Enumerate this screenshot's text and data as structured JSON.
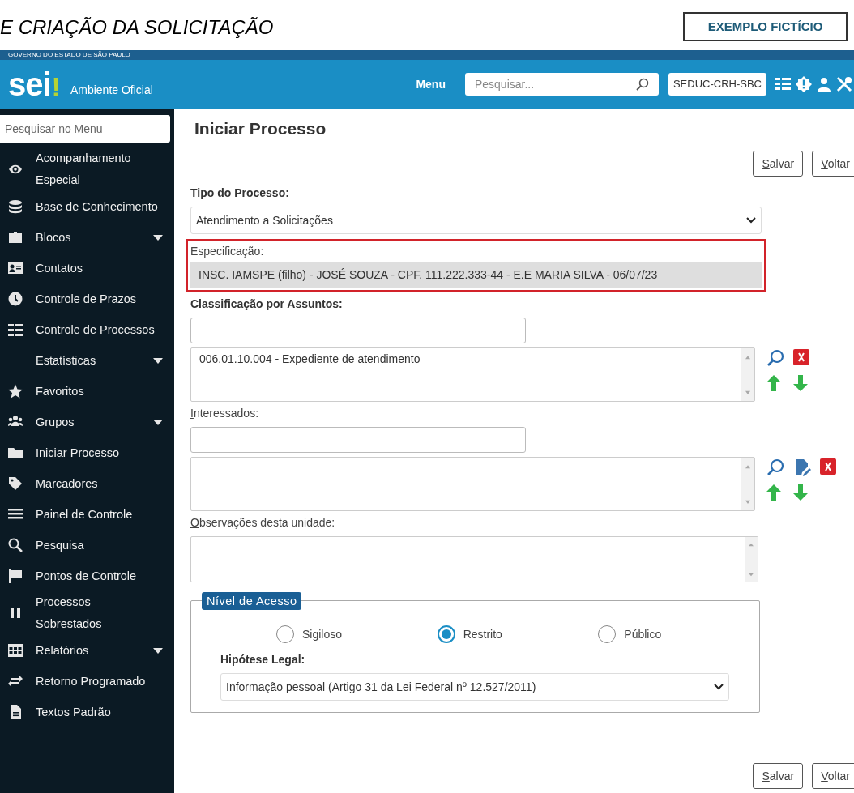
{
  "banner": {
    "title": "E CRIAÇÃO DA SOLICITAÇÃO",
    "tag": "EXEMPLO FICTÍCIO"
  },
  "header": {
    "government": "GOVERNO DO ESTADO DE SÃO PAULO",
    "logo": "sei",
    "logo_mark": "!",
    "environment": "Ambiente Oficial",
    "menu": "Menu",
    "search": {
      "placeholder": "Pesquisar..."
    },
    "unit": "SEDUC-CRH-SBC"
  },
  "sidebar": {
    "search": {
      "placeholder": "Pesquisar no Menu"
    },
    "items": [
      {
        "label": "Acompanhamento Especial",
        "submenu": false
      },
      {
        "label": "Base de Conhecimento",
        "submenu": false
      },
      {
        "label": "Blocos",
        "submenu": true
      },
      {
        "label": "Contatos",
        "submenu": false
      },
      {
        "label": "Controle de Prazos",
        "submenu": false
      },
      {
        "label": "Controle de Processos",
        "submenu": false
      },
      {
        "label": "Estatísticas",
        "submenu": true
      },
      {
        "label": "Favoritos",
        "submenu": false
      },
      {
        "label": "Grupos",
        "submenu": true
      },
      {
        "label": "Iniciar Processo",
        "submenu": false
      },
      {
        "label": "Marcadores",
        "submenu": false
      },
      {
        "label": "Painel de Controle",
        "submenu": false
      },
      {
        "label": "Pesquisa",
        "submenu": false
      },
      {
        "label": "Pontos de Controle",
        "submenu": false
      },
      {
        "label": "Processos Sobrestados",
        "submenu": false
      },
      {
        "label": "Relatórios",
        "submenu": true
      },
      {
        "label": "Retorno Programado",
        "submenu": false
      },
      {
        "label": "Textos Padrão",
        "submenu": false
      }
    ]
  },
  "page": {
    "title": "Iniciar Processo",
    "buttons_top": [
      {
        "key": "S",
        "after": "alvar"
      },
      {
        "key": "V",
        "after": "oltar"
      }
    ],
    "tipo": {
      "label": "Tipo do Processo:",
      "value": "Atendimento a Solicitações"
    },
    "especificacao": {
      "label": "Especificação:",
      "value": "INSC. IAMSPE (filho) - JOSÉ SOUZA - CPF. 111.222.333-44 - E.E MARIA SILVA - 06/07/23",
      "highlighted": true
    },
    "classificacao": {
      "before": "Classificação por Ass",
      "key": "u",
      "after": "ntos:",
      "items": [
        "006.01.10.004 - Expediente de atendimento"
      ]
    },
    "interessados": {
      "key": "I",
      "after": "nteressados:"
    },
    "observacoes": {
      "key": "O",
      "after": "bservações desta unidade:"
    },
    "nivel": {
      "legend": "Nível de Acesso",
      "options": [
        {
          "label": "Sigiloso",
          "selected": false
        },
        {
          "label": "Restrito",
          "selected": true
        },
        {
          "label": "Público",
          "selected": false
        }
      ],
      "hipotese": {
        "label": "Hipótese Legal:",
        "value": "Informação pessoal (Artigo 31 da Lei Federal nº 12.527/2011)"
      }
    },
    "buttons_bottom": [
      {
        "key": "S",
        "after": "alvar"
      },
      {
        "key": "V",
        "after": "oltar"
      }
    ]
  }
}
